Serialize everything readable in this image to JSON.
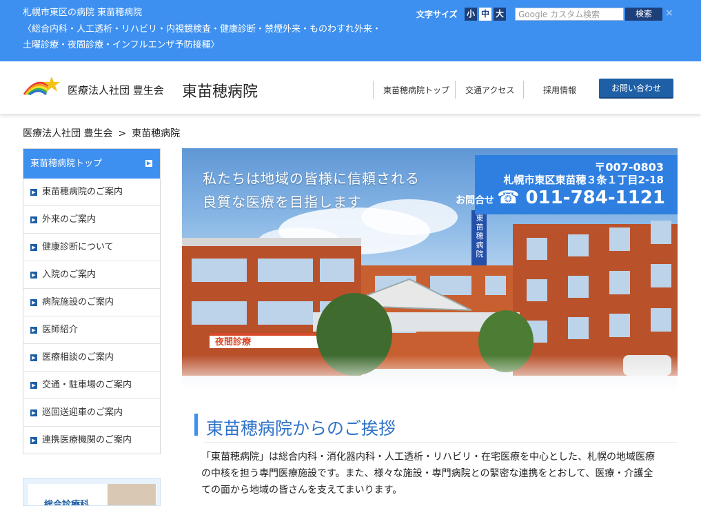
{
  "topbar": {
    "line1": "札幌市東区の病院 東苗穂病院",
    "line2": "〈総合内科・人工透析・リハビリ・内視鏡検査・健康診断・禁煙外来・ものわすれ外来・",
    "line3": "土曜診療・夜間診療・インフルエンザ予防接種〉",
    "font_size_label": "文字サイズ",
    "font_small": "小",
    "font_medium": "中",
    "font_large": "大",
    "search_placeholder": "Google カスタム検索",
    "search_button": "検索",
    "close": "×"
  },
  "header": {
    "org": "医療法人社団 豊生会",
    "hospital": "東苗穂病院",
    "nav": [
      "東苗穂病院トップ",
      "交通アクセス",
      "採用情報"
    ],
    "contact": "お問い合わせ"
  },
  "breadcrumb": {
    "items": [
      "医療法人社団 豊生会",
      "東苗穂病院"
    ],
    "separator": ">"
  },
  "sidebar": {
    "top": "東苗穂病院トップ",
    "items": [
      "東苗穂病院のご案内",
      "外来のご案内",
      "健康診断について",
      "入院のご案内",
      "病院施設のご案内",
      "医師紹介",
      "医療相談のご案内",
      "交通・駐車場のご案内",
      "巡回送迎車のご案内",
      "連携医療機関のご案内"
    ],
    "banner": "総合診療科"
  },
  "hero": {
    "tagline1": "私たちは地域の皆様に信頼される",
    "tagline2": "良質な医療を目指します",
    "zip": "〒007-0803",
    "address": "札幌市東区東苗穂３条１丁目2-18",
    "tel_label": "お問合せ",
    "tel": "☎ 011-784-1121",
    "building_sign": "東苗穂病院",
    "night_sign": "夜間診療"
  },
  "main": {
    "heading": "東苗穂病院からのご挨拶",
    "intro": "「東苗穂病院」は総合内科・消化器内科・人工透析・リハビリ・在宅医療を中心とした、札幌の地域医療の中核を担う専門医療施設です。また、様々な施設・専門病院との緊密な連携をとおして、医療・介護全ての面から地域の皆さんを支えてまいります。"
  },
  "colors": {
    "topbar": "#3e90f0",
    "navy": "#1e5fa6",
    "accent": "#2f73c9"
  }
}
